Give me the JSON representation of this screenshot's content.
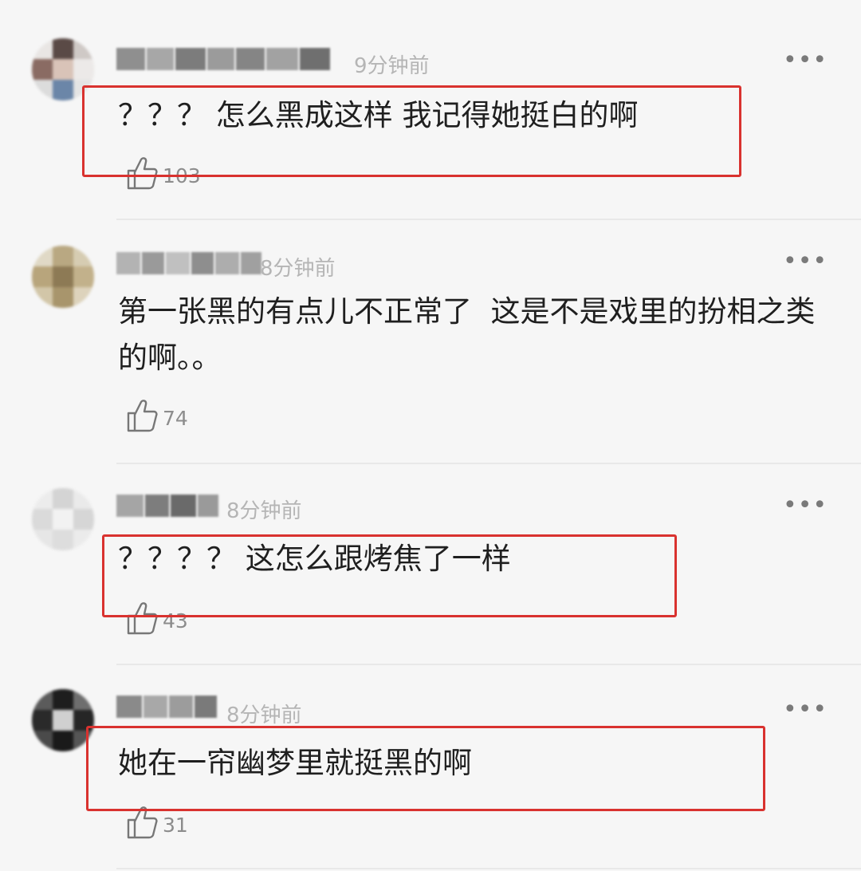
{
  "comments": [
    {
      "time": "9分钟前",
      "more": "•••",
      "text": "？？？ 怎么黑成这样 我记得她挺白的啊",
      "likes": "103",
      "highlighted": true
    },
    {
      "time": "8分钟前",
      "more": "•••",
      "text": "第一张黑的有点儿不正常了  这是不是戏里的扮相之类的啊。。",
      "likes": "74",
      "highlighted": false
    },
    {
      "time": "8分钟前",
      "more": "•••",
      "text": "？？？？ 这怎么跟烤焦了一样",
      "likes": "43",
      "highlighted": true
    },
    {
      "time": "8分钟前",
      "more": "•••",
      "text": "她在一帘幽梦里就挺黑的啊",
      "likes": "31",
      "highlighted": true
    }
  ],
  "colors": {
    "highlight_box": "#d9322f",
    "text": "#1f1f1f",
    "meta": "#b5b5b5",
    "background": "#f6f6f6"
  },
  "icons": {
    "like": "thumbs-up-icon",
    "more": "more-dots-icon",
    "avatar": "avatar"
  }
}
